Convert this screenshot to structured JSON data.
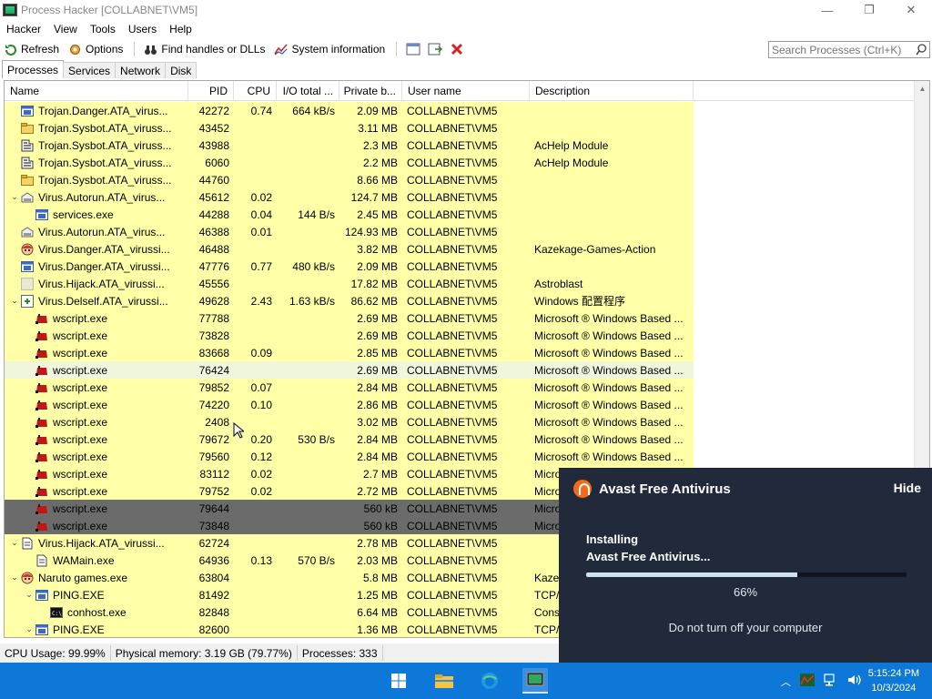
{
  "window": {
    "title": "Process Hacker [COLLABNET\\VM5]",
    "controls": [
      "—",
      "❐",
      "✕"
    ]
  },
  "menu": [
    "Hacker",
    "View",
    "Tools",
    "Users",
    "Help"
  ],
  "toolbar": {
    "refresh": "Refresh",
    "options": "Options",
    "find_handles": "Find handles or DLLs",
    "system_info": "System information",
    "search_placeholder": "Search Processes (Ctrl+K)"
  },
  "tabs": [
    "Processes",
    "Services",
    "Network",
    "Disk"
  ],
  "columns": [
    "Name",
    "PID",
    "CPU",
    "I/O total ...",
    "Private b...",
    "User name",
    "Description"
  ],
  "rows": [
    {
      "indent": 1,
      "arrow": "",
      "icon": "app",
      "name": "Trojan.Danger.ATA_virus...",
      "pid": "42272",
      "cpu": "0.74",
      "io": "664 kB/s",
      "priv": "2.09 MB",
      "user": "COLLABNET\\VM5",
      "desc": "",
      "style": "yellow"
    },
    {
      "indent": 1,
      "arrow": "",
      "icon": "folder",
      "name": "Trojan.Sysbot.ATA_viruss...",
      "pid": "43452",
      "cpu": "",
      "io": "",
      "priv": "3.11 MB",
      "user": "COLLABNET\\VM5",
      "desc": "",
      "style": "yellow"
    },
    {
      "indent": 1,
      "arrow": "",
      "icon": "chart",
      "name": "Trojan.Sysbot.ATA_viruss...",
      "pid": "43988",
      "cpu": "",
      "io": "",
      "priv": "2.3 MB",
      "user": "COLLABNET\\VM5",
      "desc": "AcHelp Module",
      "style": "yellow"
    },
    {
      "indent": 1,
      "arrow": "",
      "icon": "chart",
      "name": "Trojan.Sysbot.ATA_viruss...",
      "pid": "6060",
      "cpu": "",
      "io": "",
      "priv": "2.2 MB",
      "user": "COLLABNET\\VM5",
      "desc": "AcHelp Module",
      "style": "yellow"
    },
    {
      "indent": 1,
      "arrow": "",
      "icon": "folder",
      "name": "Trojan.Sysbot.ATA_viruss...",
      "pid": "44760",
      "cpu": "",
      "io": "",
      "priv": "8.66 MB",
      "user": "COLLABNET\\VM5",
      "desc": "",
      "style": "yellow"
    },
    {
      "indent": 1,
      "arrow": "⌄",
      "icon": "drive",
      "name": "Virus.Autorun.ATA_virus...",
      "pid": "45612",
      "cpu": "0.02",
      "io": "",
      "priv": "124.7 MB",
      "user": "COLLABNET\\VM5",
      "desc": "",
      "style": "yellow"
    },
    {
      "indent": 2,
      "arrow": "",
      "icon": "app",
      "name": "services.exe",
      "pid": "44288",
      "cpu": "0.04",
      "io": "144 B/s",
      "priv": "2.45 MB",
      "user": "COLLABNET\\VM5",
      "desc": "",
      "style": "yellow"
    },
    {
      "indent": 1,
      "arrow": "",
      "icon": "drive",
      "name": "Virus.Autorun.ATA_virus...",
      "pid": "46388",
      "cpu": "0.01",
      "io": "",
      "priv": "124.93 MB",
      "user": "COLLABNET\\VM5",
      "desc": "",
      "style": "yellow"
    },
    {
      "indent": 1,
      "arrow": "",
      "icon": "face",
      "name": "Virus.Danger.ATA_virussi...",
      "pid": "46488",
      "cpu": "",
      "io": "",
      "priv": "3.82 MB",
      "user": "COLLABNET\\VM5",
      "desc": "Kazekage-Games-Action",
      "style": "yellow"
    },
    {
      "indent": 1,
      "arrow": "",
      "icon": "app",
      "name": "Virus.Danger.ATA_virussi...",
      "pid": "47776",
      "cpu": "0.77",
      "io": "480 kB/s",
      "priv": "2.09 MB",
      "user": "COLLABNET\\VM5",
      "desc": "",
      "style": "yellow"
    },
    {
      "indent": 1,
      "arrow": "",
      "icon": "blank",
      "name": "Virus.Hijack.ATA_virussi...",
      "pid": "45556",
      "cpu": "",
      "io": "",
      "priv": "17.82 MB",
      "user": "COLLABNET\\VM5",
      "desc": "Astroblast",
      "style": "yellow"
    },
    {
      "indent": 1,
      "arrow": "⌄",
      "icon": "install",
      "name": "Virus.Delself.ATA_virussi...",
      "pid": "49628",
      "cpu": "2.43",
      "io": "1.63 kB/s",
      "priv": "86.62 MB",
      "user": "COLLABNET\\VM5",
      "desc": "Windows 配置程序",
      "style": "yellow"
    },
    {
      "indent": 2,
      "arrow": "",
      "icon": "script",
      "name": "wscript.exe",
      "pid": "77788",
      "cpu": "",
      "io": "",
      "priv": "2.69 MB",
      "user": "COLLABNET\\VM5",
      "desc": "Microsoft ® Windows Based ...",
      "style": "yellow"
    },
    {
      "indent": 2,
      "arrow": "",
      "icon": "script",
      "name": "wscript.exe",
      "pid": "73828",
      "cpu": "",
      "io": "",
      "priv": "2.69 MB",
      "user": "COLLABNET\\VM5",
      "desc": "Microsoft ® Windows Based ...",
      "style": "yellow"
    },
    {
      "indent": 2,
      "arrow": "",
      "icon": "script",
      "name": "wscript.exe",
      "pid": "83668",
      "cpu": "0.09",
      "io": "",
      "priv": "2.85 MB",
      "user": "COLLABNET\\VM5",
      "desc": "Microsoft ® Windows Based ...",
      "style": "yellow"
    },
    {
      "indent": 2,
      "arrow": "",
      "icon": "script",
      "name": "wscript.exe",
      "pid": "76424",
      "cpu": "",
      "io": "",
      "priv": "2.69 MB",
      "user": "COLLABNET\\VM5",
      "desc": "Microsoft ® Windows Based ...",
      "style": "sel"
    },
    {
      "indent": 2,
      "arrow": "",
      "icon": "script",
      "name": "wscript.exe",
      "pid": "79852",
      "cpu": "0.07",
      "io": "",
      "priv": "2.84 MB",
      "user": "COLLABNET\\VM5",
      "desc": "Microsoft ® Windows Based ...",
      "style": "yellow"
    },
    {
      "indent": 2,
      "arrow": "",
      "icon": "script",
      "name": "wscript.exe",
      "pid": "74220",
      "cpu": "0.10",
      "io": "",
      "priv": "2.86 MB",
      "user": "COLLABNET\\VM5",
      "desc": "Microsoft ® Windows Based ...",
      "style": "yellow"
    },
    {
      "indent": 2,
      "arrow": "",
      "icon": "script",
      "name": "wscript.exe",
      "pid": "2408",
      "cpu": "",
      "io": "",
      "priv": "3.02 MB",
      "user": "COLLABNET\\VM5",
      "desc": "Microsoft ® Windows Based ...",
      "style": "yellow"
    },
    {
      "indent": 2,
      "arrow": "",
      "icon": "script",
      "name": "wscript.exe",
      "pid": "79672",
      "cpu": "0.20",
      "io": "530 B/s",
      "priv": "2.84 MB",
      "user": "COLLABNET\\VM5",
      "desc": "Microsoft ® Windows Based ...",
      "style": "yellow"
    },
    {
      "indent": 2,
      "arrow": "",
      "icon": "script",
      "name": "wscript.exe",
      "pid": "79560",
      "cpu": "0.12",
      "io": "",
      "priv": "2.84 MB",
      "user": "COLLABNET\\VM5",
      "desc": "Microsoft ® Windows Based ...",
      "style": "yellow"
    },
    {
      "indent": 2,
      "arrow": "",
      "icon": "script",
      "name": "wscript.exe",
      "pid": "83112",
      "cpu": "0.02",
      "io": "",
      "priv": "2.7 MB",
      "user": "COLLABNET\\VM5",
      "desc": "Micro",
      "style": "yellow"
    },
    {
      "indent": 2,
      "arrow": "",
      "icon": "script",
      "name": "wscript.exe",
      "pid": "79752",
      "cpu": "0.02",
      "io": "",
      "priv": "2.72 MB",
      "user": "COLLABNET\\VM5",
      "desc": "Micro",
      "style": "yellow"
    },
    {
      "indent": 2,
      "arrow": "",
      "icon": "script",
      "name": "wscript.exe",
      "pid": "79644",
      "cpu": "",
      "io": "",
      "priv": "560 kB",
      "user": "COLLABNET\\VM5",
      "desc": "Micro",
      "style": "dark"
    },
    {
      "indent": 2,
      "arrow": "",
      "icon": "script",
      "name": "wscript.exe",
      "pid": "73848",
      "cpu": "",
      "io": "",
      "priv": "560 kB",
      "user": "COLLABNET\\VM5",
      "desc": "Micro",
      "style": "dark"
    },
    {
      "indent": 1,
      "arrow": "⌄",
      "icon": "doc",
      "name": "Virus.Hijack.ATA_virussi...",
      "pid": "62724",
      "cpu": "",
      "io": "",
      "priv": "2.78 MB",
      "user": "COLLABNET\\VM5",
      "desc": "",
      "style": "yellow"
    },
    {
      "indent": 2,
      "arrow": "",
      "icon": "doc",
      "name": "WAMain.exe",
      "pid": "64936",
      "cpu": "0.13",
      "io": "570 B/s",
      "priv": "2.03 MB",
      "user": "COLLABNET\\VM5",
      "desc": "",
      "style": "yellow"
    },
    {
      "indent": 1,
      "arrow": "⌄",
      "icon": "face",
      "name": "Naruto games.exe",
      "pid": "63804",
      "cpu": "",
      "io": "",
      "priv": "5.8 MB",
      "user": "COLLABNET\\VM5",
      "desc": "Kaze",
      "style": "yellow"
    },
    {
      "indent": 2,
      "arrow": "⌄",
      "icon": "app",
      "name": "PING.EXE",
      "pid": "81492",
      "cpu": "",
      "io": "",
      "priv": "1.25 MB",
      "user": "COLLABNET\\VM5",
      "desc": "TCP/",
      "style": "yellow"
    },
    {
      "indent": 3,
      "arrow": "",
      "icon": "console",
      "name": "conhost.exe",
      "pid": "82848",
      "cpu": "",
      "io": "",
      "priv": "6.64 MB",
      "user": "COLLABNET\\VM5",
      "desc": "Cons",
      "style": "yellow"
    },
    {
      "indent": 2,
      "arrow": "⌄",
      "icon": "app",
      "name": "PING.EXE",
      "pid": "82600",
      "cpu": "",
      "io": "",
      "priv": "1.36 MB",
      "user": "COLLABNET\\VM5",
      "desc": "TCP/",
      "style": "yellow"
    }
  ],
  "status": {
    "cpu": "CPU Usage: 99.99%",
    "memory": "Physical memory: 3.19 GB (79.77%)",
    "processes": "Processes: 333"
  },
  "avast": {
    "title": "Avast Free Antivirus",
    "hide": "Hide",
    "line1": "Installing",
    "line2": "Avast Free Antivirus...",
    "progress": 66,
    "progress_text": "66%",
    "warning": "Do not turn off your computer"
  },
  "taskbar": {
    "time": "5:15:24 PM",
    "date": "10/3/2024"
  },
  "colors": {
    "highlight_yellow": "#ffffa8",
    "avast_bg": "#212a3a",
    "avast_orange": "#f36a1a",
    "taskbar": "#0e78d8"
  }
}
